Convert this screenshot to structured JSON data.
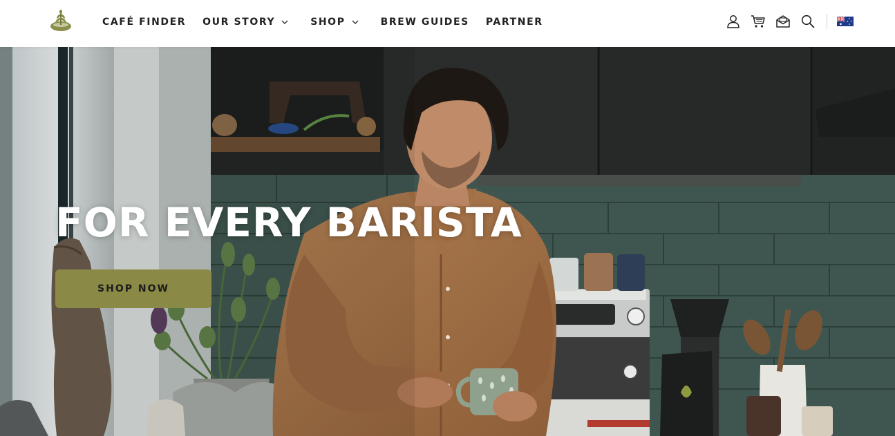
{
  "brand": {
    "logo_icon": "coffee-plant-bowl-logo",
    "accent_color": "#8a8a46"
  },
  "nav": {
    "items": [
      {
        "label": "CAFÉ FINDER",
        "has_dropdown": false
      },
      {
        "label": "OUR STORY",
        "has_dropdown": true
      },
      {
        "label": "SHOP",
        "has_dropdown": true
      },
      {
        "label": "BREW GUIDES",
        "has_dropdown": false
      },
      {
        "label": "PARTNER",
        "has_dropdown": false
      }
    ]
  },
  "utilities": {
    "icons": [
      "user-icon",
      "cart-icon",
      "mail-icon",
      "search-icon"
    ],
    "region_flag": "australia-flag-icon"
  },
  "hero": {
    "title": "FOR EVERY BARISTA",
    "cta_label": "SHOP NOW",
    "cta_color": "#8a8a46",
    "image": "man-holding-mug-in-kitchen-photo"
  }
}
